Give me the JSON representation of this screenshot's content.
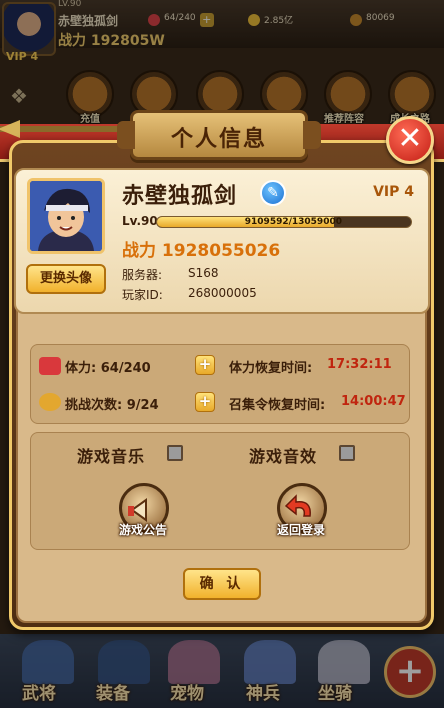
{
  "hud": {
    "level": "LV.90",
    "player_name": "赤壁独孤剑",
    "power_label": "战力",
    "power_value": "192805W",
    "stamina": "64/240",
    "coins": "2.85亿",
    "gems": "80069",
    "vip": "VIP 4",
    "icons": [
      {
        "label": "充值",
        "icon": "recharge-icon"
      },
      {
        "label": "推荐阵容",
        "icon": "recommend-team-icon"
      },
      {
        "label": "成长之路",
        "icon": "growth-path-icon"
      }
    ]
  },
  "dialog": {
    "title": "个人信息",
    "close_icon": "close-icon",
    "profile": {
      "name": "赤壁独孤剑",
      "vip": "VIP 4",
      "level_prefix": "Lv.90",
      "exp_text": "9109592/13059000",
      "exp_fraction": 0.698,
      "power_label": "战力",
      "power_value": "1928055026",
      "server_label": "服务器:",
      "server_value": "S168",
      "player_id_label": "玩家ID:",
      "player_id_value": "268000005",
      "change_avatar_label": "更换头像"
    },
    "stats": {
      "stamina_label": "体力:",
      "stamina_value": "64/240",
      "stamina_recover_label": "体力恢复时间:",
      "stamina_recover_time": "17:32:11",
      "challenge_label": "挑战次数:",
      "challenge_value": "9/24",
      "summon_recover_label": "召集令恢复时间:",
      "summon_recover_time": "14:00:47"
    },
    "settings": {
      "music_label": "游戏音乐",
      "sound_label": "游戏音效",
      "music_enabled": false,
      "sound_enabled": false,
      "announcement_label": "游戏公告",
      "return_login_label": "返回登录"
    },
    "confirm_label": "确 认"
  },
  "bottom_nav": [
    {
      "label": "武将",
      "icon": "generals-icon"
    },
    {
      "label": "装备",
      "icon": "equipment-icon"
    },
    {
      "label": "宠物",
      "icon": "pet-icon"
    },
    {
      "label": "神兵",
      "icon": "divine-weapon-icon"
    },
    {
      "label": "坐骑",
      "icon": "mount-icon"
    }
  ],
  "colors": {
    "accent_gold": "#f1b12c",
    "timer_red": "#c0250f",
    "power_orange": "#d8700a",
    "close_red": "#c21d14"
  }
}
